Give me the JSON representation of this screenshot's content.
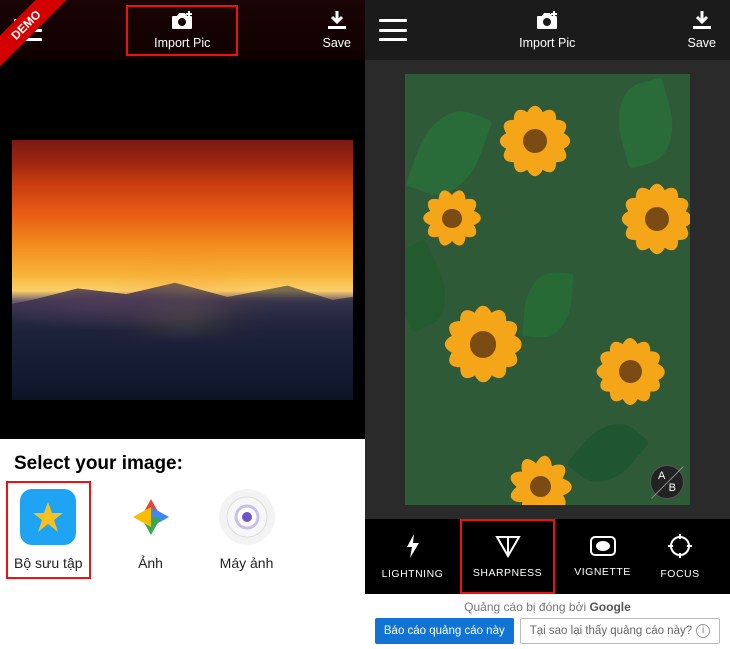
{
  "left": {
    "demo_label": "DEMO",
    "topbar": {
      "import_label": "Import Pic",
      "save_label": "Save"
    },
    "sheet": {
      "title": "Select your image:",
      "sources": [
        {
          "label": "Bộ sưu tập",
          "icon": "gallery-icon"
        },
        {
          "label": "Ảnh",
          "icon": "photos-icon"
        },
        {
          "label": "Máy ảnh",
          "icon": "camera-icon"
        }
      ]
    }
  },
  "right": {
    "topbar": {
      "import_label": "Import Pic",
      "save_label": "Save"
    },
    "ab_compare": {
      "a": "A",
      "b": "B"
    },
    "tools": [
      {
        "label": "LIGHTNING",
        "icon": "bolt-icon"
      },
      {
        "label": "SHARPNESS",
        "icon": "triangle-down-icon"
      },
      {
        "label": "VIGNETTE",
        "icon": "vignette-icon"
      },
      {
        "label": "FOCUS",
        "icon": "target-icon"
      }
    ],
    "ad": {
      "closed_text": "Quảng cáo bị đóng bởi ",
      "provider": "Google",
      "report_btn": "Báo cáo quảng cáo này",
      "why_btn": "Tại sao lại thấy quảng cáo này?"
    }
  }
}
